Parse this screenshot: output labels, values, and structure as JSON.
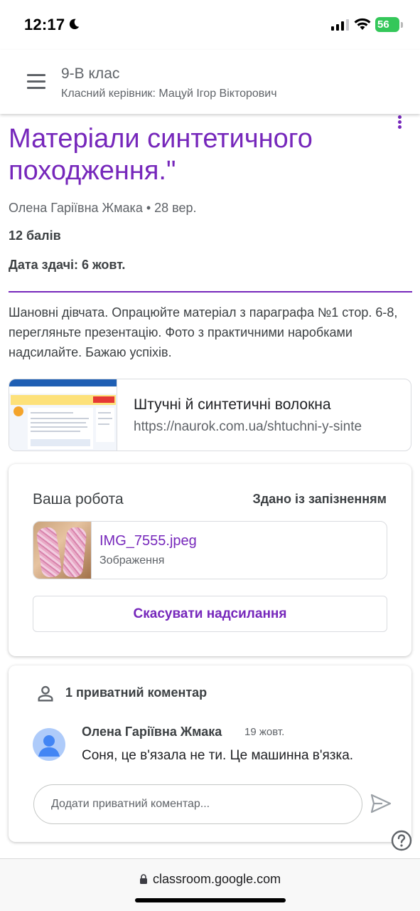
{
  "status_bar": {
    "time": "12:17",
    "battery": "56"
  },
  "header": {
    "class_name": "9-В клас",
    "teacher": "Класний керівник: Мацуй Ігор Вікторович"
  },
  "assignment": {
    "title": "Матеріали синтетичного походження.\"",
    "meta": "Олена Гаріївна Жмака • 28 вер.",
    "points": "12 балів",
    "due": "Дата здачі: 6 жовт.",
    "description": "Шановні дівчата. Опрацюйте матеріал з параграфа №1 стор. 6-8, перегляньте презентацію. Фото з практичними наробками надсилайте. Бажаю успіхів.",
    "accent_color": "#7627bb"
  },
  "link": {
    "title": "Штучні й синтетичні волокна",
    "url": "https://naurok.com.ua/shtuchni-y-sinte"
  },
  "your_work": {
    "heading": "Ваша робота",
    "status": "Здано із запізненням",
    "attachment": {
      "name": "IMG_7555.jpeg",
      "type": "Зображення"
    },
    "unsubmit_label": "Скасувати надсилання"
  },
  "comments": {
    "heading": "1 приватний коментар",
    "items": [
      {
        "author": "Олена Гаріївна Жмака",
        "date": "19 жовт.",
        "text": "Соня, це в'язала не ти. Це машинна в'язка."
      }
    ],
    "input_placeholder": "Додати приватний коментар..."
  },
  "browser": {
    "url": "classroom.google.com"
  },
  "icons": {
    "menu": "menu-icon",
    "more": "more-vert-icon",
    "person": "person-icon",
    "send": "send-icon",
    "help": "help-icon",
    "lock": "lock-icon"
  }
}
